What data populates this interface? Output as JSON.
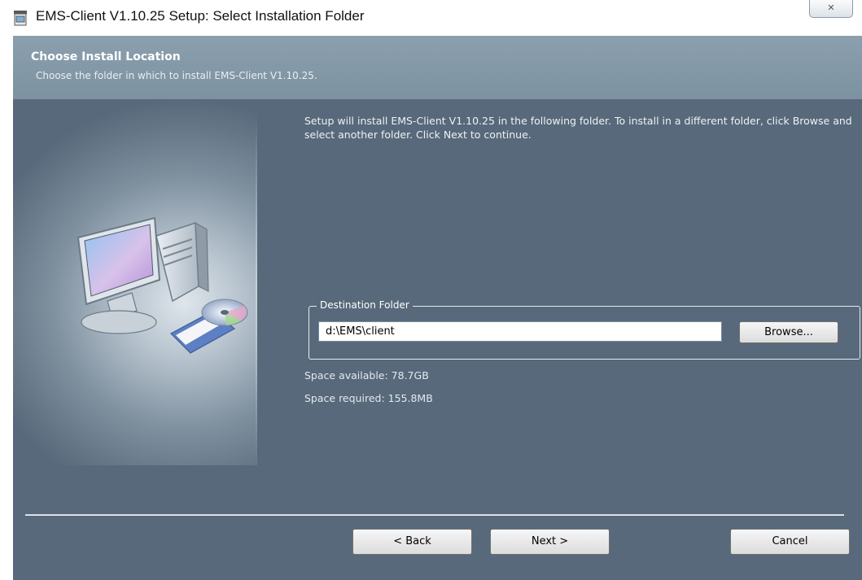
{
  "window": {
    "title": "EMS-Client V1.10.25 Setup: Select Installation Folder",
    "close_glyph": "✕"
  },
  "header": {
    "title": "Choose Install Location",
    "subtitle": "Choose the folder in which to install EMS-Client V1.10.25."
  },
  "main": {
    "intro": "Setup will install EMS-Client V1.10.25 in the following folder. To install in a different folder, click Browse and select another folder. Click Next to continue.",
    "destination": {
      "label": "Destination Folder",
      "path": "d:\\EMS\\client",
      "browse_label": "Browse..."
    },
    "space_available": "Space available: 78.7GB",
    "space_required": "Space required: 155.8MB"
  },
  "footer": {
    "back_label": "< Back",
    "next_label": "Next >",
    "cancel_label": "Cancel"
  },
  "icons": {
    "app": "installer-icon",
    "illustration": "computer-with-disc-icon"
  },
  "colors": {
    "body_bg": "#57697a",
    "header_bg": "#8b9fae"
  }
}
